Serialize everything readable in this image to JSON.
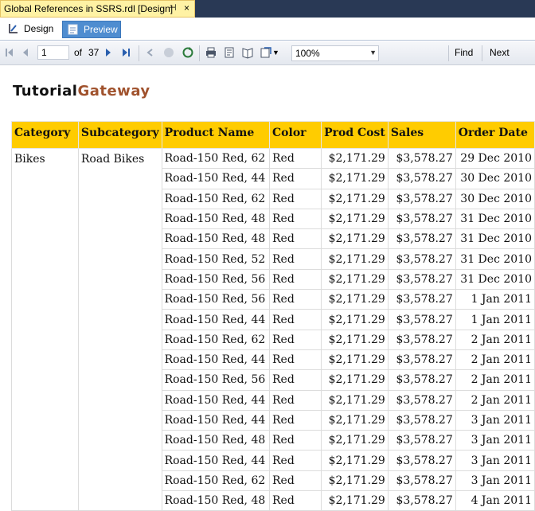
{
  "document_tab": {
    "title": "Global References in SSRS.rdl [Design]",
    "pin": "⊣",
    "close": "×"
  },
  "view_tabs": {
    "design": "Design",
    "preview": "Preview"
  },
  "toolbar": {
    "page": "1",
    "of_label": "of",
    "total_pages": "37",
    "zoom": "100%",
    "find": "Find",
    "next": "Next"
  },
  "logo": {
    "part1": "Tutorial",
    "part2": "Gateway"
  },
  "table": {
    "headers": [
      "Category",
      "Subcategory",
      "Product Name",
      "Color",
      "Prod Cost",
      "Sales",
      "Order Date"
    ],
    "category": "Bikes",
    "subcategory": "Road Bikes",
    "rows": [
      [
        "Road-150 Red, 62",
        "Red",
        "$2,171.29",
        "$3,578.27",
        "29 Dec 2010"
      ],
      [
        "Road-150 Red, 44",
        "Red",
        "$2,171.29",
        "$3,578.27",
        "30 Dec 2010"
      ],
      [
        "Road-150 Red, 62",
        "Red",
        "$2,171.29",
        "$3,578.27",
        "30 Dec 2010"
      ],
      [
        "Road-150 Red, 48",
        "Red",
        "$2,171.29",
        "$3,578.27",
        "31 Dec 2010"
      ],
      [
        "Road-150 Red, 48",
        "Red",
        "$2,171.29",
        "$3,578.27",
        "31 Dec 2010"
      ],
      [
        "Road-150 Red, 52",
        "Red",
        "$2,171.29",
        "$3,578.27",
        "31 Dec 2010"
      ],
      [
        "Road-150 Red, 56",
        "Red",
        "$2,171.29",
        "$3,578.27",
        "31 Dec 2010"
      ],
      [
        "Road-150 Red, 56",
        "Red",
        "$2,171.29",
        "$3,578.27",
        "1 Jan 2011"
      ],
      [
        "Road-150 Red, 44",
        "Red",
        "$2,171.29",
        "$3,578.27",
        "1 Jan 2011"
      ],
      [
        "Road-150 Red, 62",
        "Red",
        "$2,171.29",
        "$3,578.27",
        "2 Jan 2011"
      ],
      [
        "Road-150 Red, 44",
        "Red",
        "$2,171.29",
        "$3,578.27",
        "2 Jan 2011"
      ],
      [
        "Road-150 Red, 56",
        "Red",
        "$2,171.29",
        "$3,578.27",
        "2 Jan 2011"
      ],
      [
        "Road-150 Red, 44",
        "Red",
        "$2,171.29",
        "$3,578.27",
        "2 Jan 2011"
      ],
      [
        "Road-150 Red, 44",
        "Red",
        "$2,171.29",
        "$3,578.27",
        "3 Jan 2011"
      ],
      [
        "Road-150 Red, 48",
        "Red",
        "$2,171.29",
        "$3,578.27",
        "3 Jan 2011"
      ],
      [
        "Road-150 Red, 44",
        "Red",
        "$2,171.29",
        "$3,578.27",
        "3 Jan 2011"
      ],
      [
        "Road-150 Red, 62",
        "Red",
        "$2,171.29",
        "$3,578.27",
        "3 Jan 2011"
      ],
      [
        "Road-150 Red, 48",
        "Red",
        "$2,171.29",
        "$3,578.27",
        "4 Jan 2011"
      ]
    ]
  },
  "colors": {
    "header_bg": "#ffcc00",
    "preview_tab": "#4f8dd0",
    "doc_tab": "#fff2a4",
    "logo_accent": "#a0522d"
  }
}
